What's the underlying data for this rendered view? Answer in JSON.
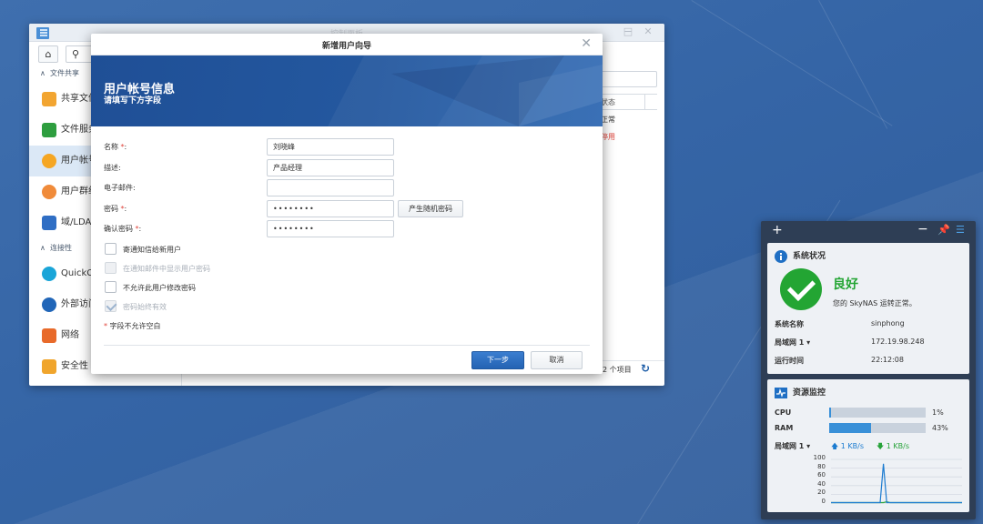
{
  "control_panel": {
    "title": "控制面板",
    "sidebar": {
      "sections": [
        {
          "label": "文件共享"
        },
        {
          "label": "连接性"
        }
      ],
      "items": [
        {
          "label": "共享文件夹",
          "icon": "shared-folder-icon",
          "color": "#f2a531"
        },
        {
          "label": "文件服务",
          "icon": "file-services-icon",
          "color": "#2e9e3f"
        },
        {
          "label": "用户帐号",
          "icon": "user-icon",
          "color": "#f5a623"
        },
        {
          "label": "用户群组",
          "icon": "user-group-icon",
          "color": "#f08b3a"
        },
        {
          "label": "域/LDAP",
          "icon": "domain-ldap-icon",
          "color": "#2f6ec4"
        },
        {
          "label": "QuickConnect",
          "icon": "quickconnect-icon",
          "color": "#1aa5d8"
        },
        {
          "label": "外部访问",
          "icon": "external-access-icon",
          "color": "#2166b8"
        },
        {
          "label": "网络",
          "icon": "network-icon",
          "color": "#e86a2a"
        },
        {
          "label": "安全性",
          "icon": "security-icon",
          "color": "#f0a52c"
        }
      ]
    },
    "table": {
      "status_header": "状态",
      "rows": [
        {
          "status": "正常",
          "color": "#333333"
        },
        {
          "status": "停用",
          "color": "#e0443b"
        }
      ]
    },
    "footer": {
      "count": "2 个项目"
    }
  },
  "dialog": {
    "title": "新增用户向导",
    "banner_title": "用户帐号信息",
    "banner_subtitle": "请填写下方字段",
    "fields": {
      "name": {
        "label": "名称",
        "value": "刘晓峰"
      },
      "description": {
        "label": "描述:",
        "value": "产品经理"
      },
      "email": {
        "label": "电子邮件:",
        "value": ""
      },
      "password": {
        "label": "密码",
        "value": "••••••••"
      },
      "confirm_password": {
        "label": "确认密码",
        "value": "••••••••"
      }
    },
    "random_password_button": "产生随机密码",
    "checkboxes": [
      {
        "label": "寄通知信给新用户",
        "checked": false,
        "disabled": false
      },
      {
        "label": "在通知邮件中显示用户密码",
        "checked": false,
        "disabled": true
      },
      {
        "label": "不允许此用户修改密码",
        "checked": false,
        "disabled": false
      },
      {
        "label": "密码始终有效",
        "checked": true,
        "disabled": true
      }
    ],
    "required_note": "字段不允许空白",
    "next_button": "下一步",
    "cancel_button": "取消"
  },
  "widgets": {
    "system_status": {
      "title": "系统状况",
      "status": "良好",
      "message": "您的 SkyNAS 运转正常。",
      "rows": [
        {
          "key": "系统名称",
          "value": "sinphong"
        },
        {
          "key": "局域网 1 ▾",
          "value": "172.19.98.248"
        },
        {
          "key": "运行时间",
          "value": "22:12:08"
        }
      ]
    },
    "resource_monitor": {
      "title": "资源监控",
      "cpu_label": "CPU",
      "cpu_percent": 1,
      "cpu_text": "1%",
      "ram_label": "RAM",
      "ram_percent": 43,
      "ram_text": "43%",
      "lan_label": "局域网 1 ▾",
      "upload": "1 KB/s",
      "download": "1 KB/s",
      "chart_ticks": [
        "100",
        "80",
        "60",
        "40",
        "20",
        "0"
      ],
      "upload_series": [
        1,
        1,
        1,
        1,
        1,
        1,
        1,
        1,
        1,
        1,
        1,
        1,
        1,
        1,
        1,
        1,
        90,
        1,
        1,
        1,
        1,
        1,
        1,
        1,
        1,
        1,
        1,
        1,
        1,
        1,
        1,
        1,
        1,
        1,
        1,
        1,
        1,
        1,
        1,
        1,
        1
      ],
      "download_series": [
        1,
        1,
        1,
        1,
        1,
        1,
        1,
        1,
        1,
        1,
        1,
        1,
        1,
        1,
        1,
        1,
        1,
        3,
        1,
        1,
        1,
        1,
        1,
        1,
        1,
        1,
        1,
        1,
        1,
        1,
        1,
        1,
        1,
        1,
        1,
        1,
        1,
        1,
        1,
        1,
        1
      ],
      "upload_color": "#1b7bd0",
      "download_color": "#27a33a"
    }
  }
}
